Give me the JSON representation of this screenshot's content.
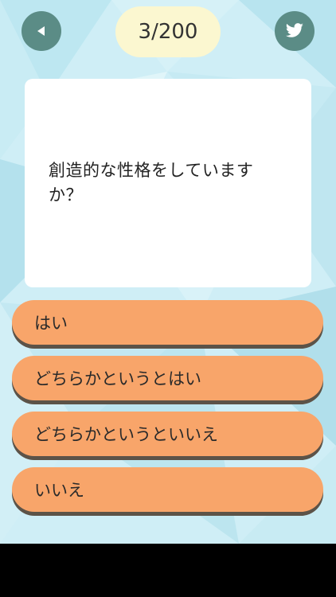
{
  "header": {
    "back_icon": "back-triangle-icon",
    "share_icon": "twitter-bird-icon",
    "progress": "3/200"
  },
  "question": {
    "text": "創造的な性格をしていますか？"
  },
  "answers": [
    {
      "label": "はい"
    },
    {
      "label": "どちらかというとはい"
    },
    {
      "label": "どちらかというといいえ"
    },
    {
      "label": "いいえ"
    }
  ],
  "colors": {
    "background": "#cfeef6",
    "round_button": "#5b8c86",
    "counter_pill": "#fbf7d0",
    "answer_button": "#f8a56a",
    "answer_shadow": "#5c5348"
  }
}
